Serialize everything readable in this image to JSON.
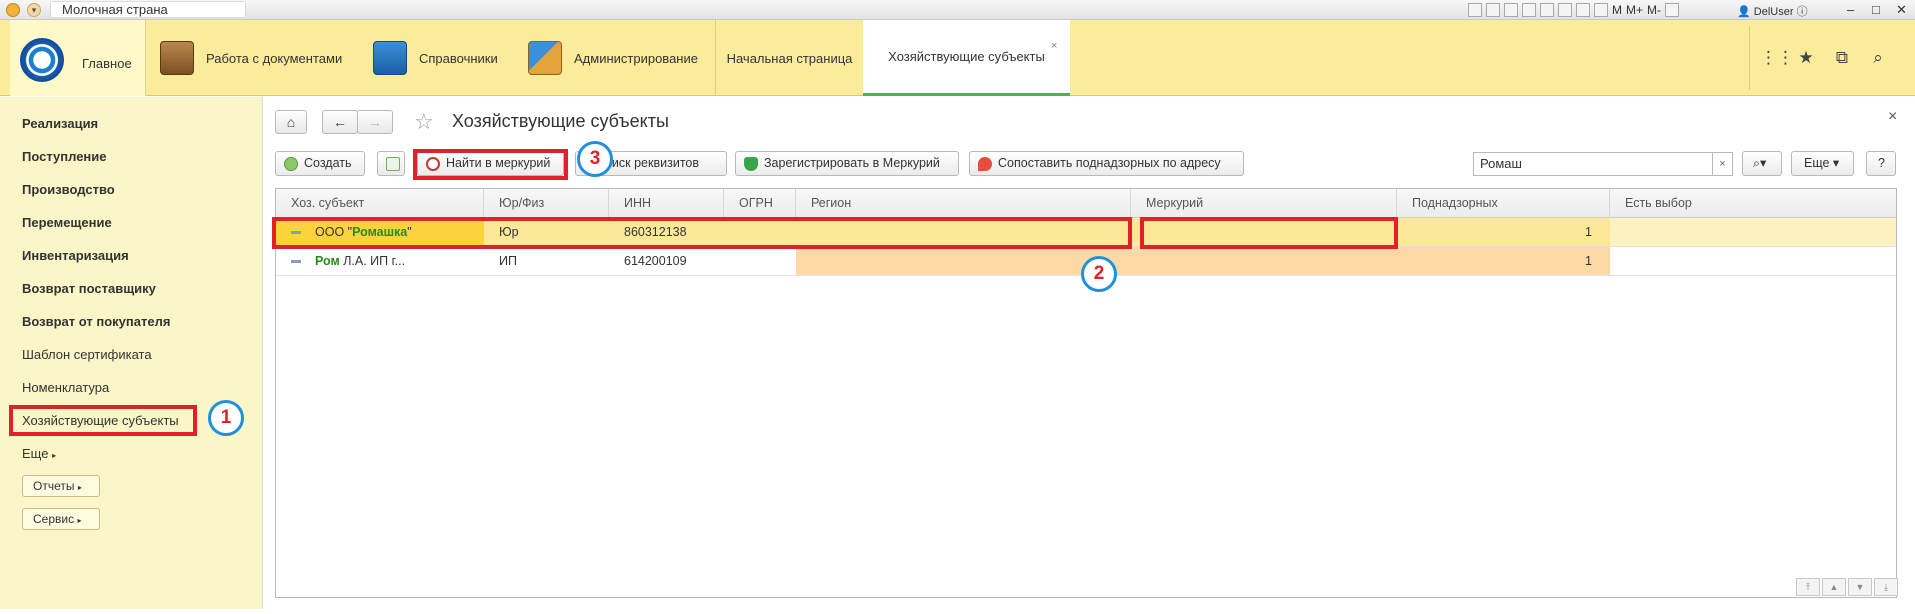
{
  "window": {
    "title": "Молочная страна",
    "toolbar_texts": [
      "M",
      "M+",
      "M-"
    ],
    "user": "DelUser"
  },
  "topbar": {
    "home_label": "Главное",
    "sections": [
      {
        "label": "Работа с документами",
        "icon": "briefcase-icon"
      },
      {
        "label": "Справочники",
        "icon": "address-book-icon"
      },
      {
        "label": "Администрирование",
        "icon": "tools-icon"
      }
    ],
    "tabs": [
      {
        "label": "Начальная страница"
      },
      {
        "label": "Хозяйствующие субъекты",
        "close": "×"
      }
    ]
  },
  "sidebar": {
    "items": [
      {
        "label": "Реализация",
        "bold": true
      },
      {
        "label": "Поступление",
        "bold": true
      },
      {
        "label": "Производство",
        "bold": true
      },
      {
        "label": "Перемещение",
        "bold": true
      },
      {
        "label": "Инвентаризация",
        "bold": true
      },
      {
        "label": "Возврат поставщику",
        "bold": true
      },
      {
        "label": "Возврат от покупателя",
        "bold": true
      },
      {
        "label": "Шаблон сертификата",
        "bold": false
      },
      {
        "label": "Номенклатура",
        "bold": false
      },
      {
        "label": "Хозяйствующие субъекты",
        "bold": false
      },
      {
        "label": "Еще",
        "bold": false
      }
    ],
    "buttons": [
      "Отчеты",
      "Сервис"
    ]
  },
  "form": {
    "title": "Хозяйствующие субъекты",
    "close": "×",
    "toolbar": {
      "create": "Создать",
      "find_mercury": "Найти в меркурий",
      "search_requisites": "Поиск реквизитов",
      "register_mercury": "Зарегистрировать в Меркурий",
      "match_by_address": "Сопоставить поднадзорных по адресу",
      "more": "Еще",
      "help": "?"
    },
    "search": {
      "value": "Ромаш",
      "clear": "×"
    }
  },
  "table": {
    "columns": [
      "Хоз. субъект",
      "Юр/Физ",
      "ИНН",
      "ОГРН",
      "Регион",
      "Меркурий",
      "Поднадзорных",
      "Есть выбор"
    ],
    "rows": [
      {
        "subject_prefix": "ООО \"",
        "subject_match": "Ромашка",
        "subject_suffix": "\"",
        "type": "Юр",
        "inn": "860312138",
        "ogrn": "",
        "region": "",
        "mercury": "",
        "supervised": "1",
        "has_choice": ""
      },
      {
        "subject_prefix": "",
        "subject_match": "Ром",
        "subject_suffix": " Л.А. ИП г...",
        "type": "ИП",
        "inn": "614200109",
        "ogrn": "",
        "region": "",
        "mercury": "",
        "supervised": "1",
        "has_choice": ""
      }
    ]
  },
  "annotations": {
    "badges": [
      "1",
      "2",
      "3"
    ],
    "highlight_color": "#e1202a",
    "badge_ring_color": "#1f8fe0"
  },
  "colors": {
    "topbar_bg": "#fbec9c",
    "sidebar_bg": "#fbf6c7",
    "selected_row": "#fde89a",
    "region_highlight": "#fdd9a8",
    "active_tab_underline": "#4caf50"
  }
}
